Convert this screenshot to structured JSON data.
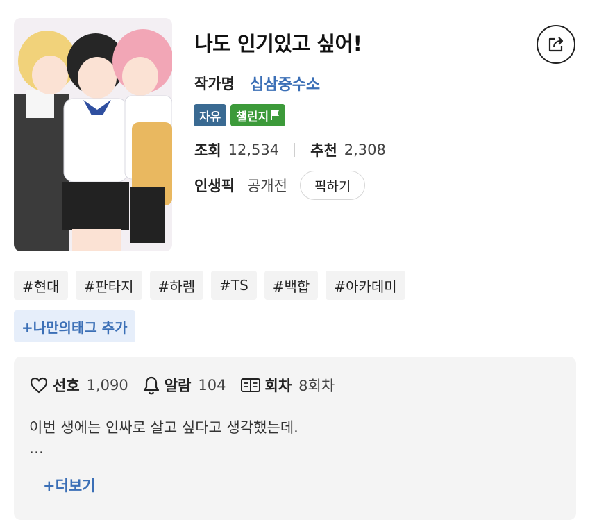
{
  "title": "나도 인기있고 싶어!",
  "author": {
    "label": "작가명",
    "name": "십삼중수소"
  },
  "badges": {
    "free": "자유",
    "challenge": "챌린지"
  },
  "stats": {
    "views_label": "조회",
    "views_value": "12,534",
    "recommend_label": "추천",
    "recommend_value": "2,308"
  },
  "pick": {
    "label": "인생픽",
    "status": "공개전",
    "button": "픽하기"
  },
  "tags": [
    "#현대",
    "#판타지",
    "#하렘",
    "#TS",
    "#백합",
    "#아카데미"
  ],
  "add_tag": "+나만의태그 추가",
  "info": {
    "likes_label": "선호",
    "likes_value": "1,090",
    "alarm_label": "알람",
    "alarm_value": "104",
    "episodes_label": "회차",
    "episodes_value": "8회차",
    "synopsis": "이번 생에는 인싸로 살고 싶다고 생각했는데.",
    "ellipsis": "…",
    "more": "+더보기"
  },
  "icons": [
    "share-icon",
    "flag-icon",
    "heart-icon",
    "bell-icon",
    "book-icon"
  ],
  "colors": {
    "accent_blue": "#3b6fb6",
    "badge_free": "#3a6a92",
    "badge_challenge": "#3c9a3a"
  }
}
